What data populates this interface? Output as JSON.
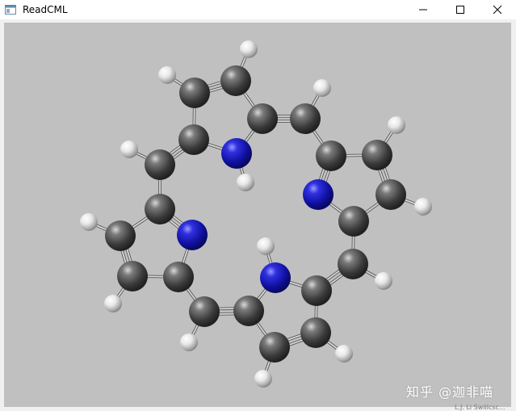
{
  "window": {
    "title": "ReadCML",
    "icon": "app-window-icon",
    "controls": [
      "minimize-icon",
      "maximize-icon",
      "close-icon"
    ]
  },
  "viewport": {
    "background": "#c0c0c0",
    "bond_color": "#d8d8d8",
    "atom_colors": {
      "C": "#4a4a4a",
      "N": "#1a1acc",
      "H": "#e6e6e6"
    }
  },
  "watermark": "知乎 @迦非喵",
  "edge_fragment": "L.J. Li Swiilcsc..."
}
